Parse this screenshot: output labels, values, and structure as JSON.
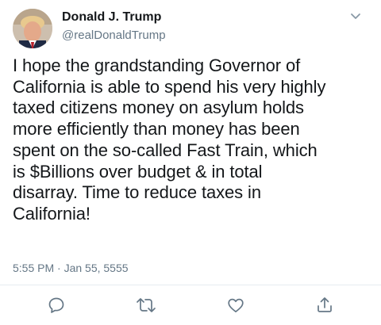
{
  "user": {
    "display_name": "Donald J. Trump",
    "handle": "@realDonaldTrump"
  },
  "tweet": {
    "lines": [
      "I hope the grandstanding Governor of",
      "California is able to spend his very highly",
      "taxed citizens money on asylum holds",
      "more efficiently than money has been",
      "spent on the so-called Fast Train, which",
      "is $Billions over budget & in total",
      "disarray. Time to reduce taxes in",
      "California!"
    ],
    "timestamp": "5:55 PM · Jan 55, 5555"
  },
  "icons": {
    "menu": "chevron-down-icon",
    "reply": "comment-bubble-icon",
    "retweet": "retweet-icon",
    "like": "heart-icon",
    "share": "share-upload-icon"
  },
  "colors": {
    "text": "#14171a",
    "secondary": "#657786",
    "icon": "#657786",
    "divider": "#e6ecf0"
  }
}
